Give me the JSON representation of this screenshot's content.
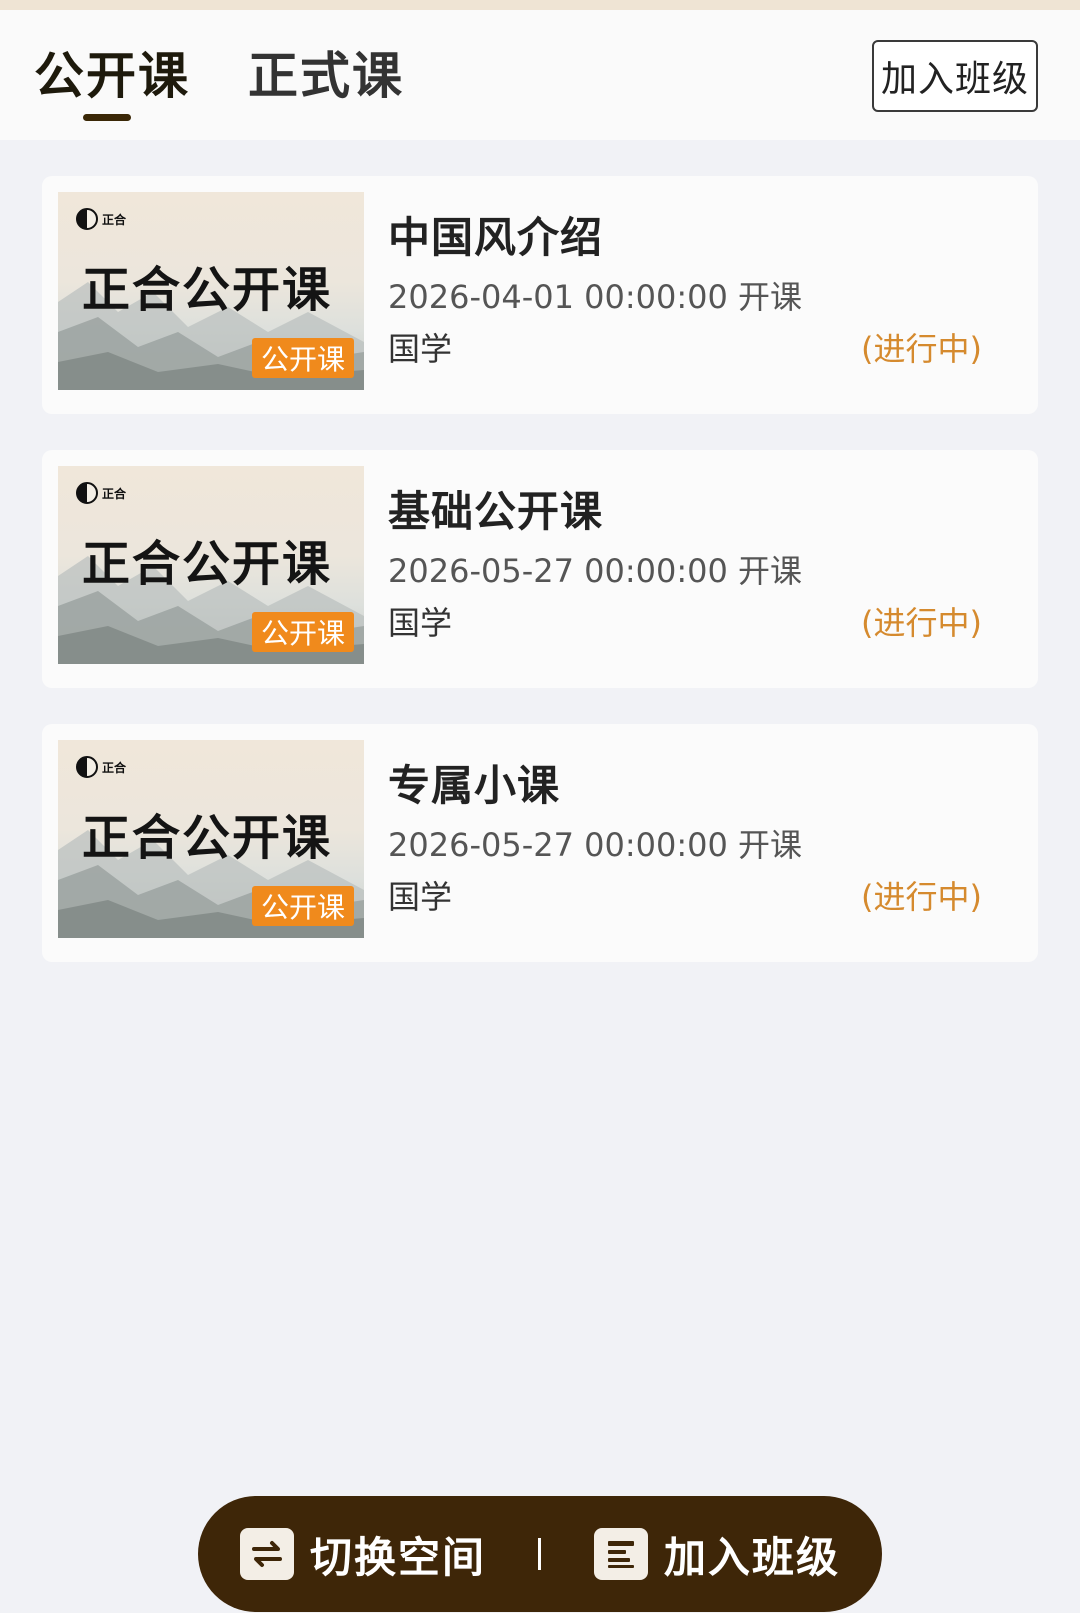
{
  "header": {
    "tabs": [
      {
        "label": "公开课",
        "active": true
      },
      {
        "label": "正式课",
        "active": false
      }
    ],
    "join_button": "加入班级"
  },
  "thumbnail": {
    "logo_text": "正合",
    "title": "正合公开课",
    "badge": "公开课"
  },
  "courses": [
    {
      "title": "中国风介绍",
      "time": "2026-04-01 00:00:00 开课",
      "category": "国学",
      "status": "(进行中)"
    },
    {
      "title": "基础公开课",
      "time": "2026-05-27 00:00:00 开课",
      "category": "国学",
      "status": "(进行中)"
    },
    {
      "title": "专属小课",
      "time": "2026-05-27 00:00:00 开课",
      "category": "国学",
      "status": "(进行中)"
    }
  ],
  "bottom_bar": {
    "switch_label": "切换空间",
    "join_label": "加入班级"
  },
  "colors": {
    "accent_dark": "#3e2608",
    "status": "#d58a2e",
    "badge": "#f08a1c"
  }
}
